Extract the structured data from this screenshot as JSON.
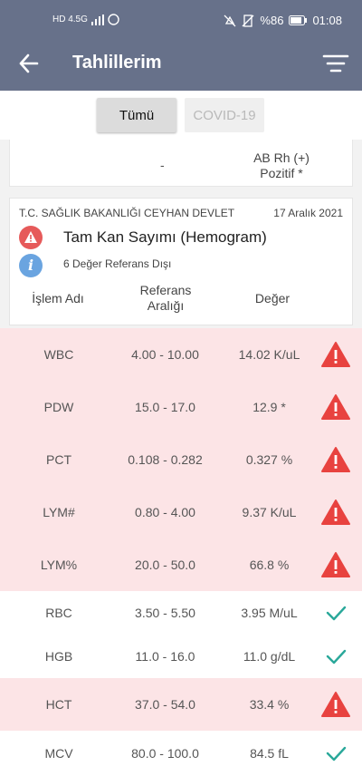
{
  "status_bar": {
    "left_text": "HD 4.5G",
    "battery": "%86",
    "time": "01:08"
  },
  "app_bar": {
    "title": "Tahlillerim",
    "back_icon": "arrow-left-icon",
    "filter_icon": "filter-icon"
  },
  "tabs": [
    {
      "label": "Tümü",
      "active": true
    },
    {
      "label": "COVID-19",
      "active": false
    }
  ],
  "prev_card": {
    "value": "-",
    "blood_group": "AB Rh (+) Pozitif *"
  },
  "test_card": {
    "hospital": "T.C. SAĞLIK BAKANLIĞI CEYHAN DEVLET",
    "date": "17 Aralık 2021",
    "title": "Tam Kan Sayımı (Hemogram)",
    "out_of_range": "6 Değer Referans Dışı",
    "info_glyph": "i",
    "columns": {
      "name": "İşlem Adı",
      "reference": "Referans Aralığı",
      "value": "Değer"
    }
  },
  "results": [
    {
      "name": "WBC",
      "reference": "4.00 - 10.00",
      "value": "14.02 K/uL",
      "status": "abnormal"
    },
    {
      "name": "PDW",
      "reference": "15.0 - 17.0",
      "value": "12.9 *",
      "status": "abnormal"
    },
    {
      "name": "PCT",
      "reference": "0.108 - 0.282",
      "value": "0.327 %",
      "status": "abnormal"
    },
    {
      "name": "LYM#",
      "reference": "0.80 - 4.00",
      "value": "9.37 K/uL",
      "status": "abnormal"
    },
    {
      "name": "LYM%",
      "reference": "20.0 - 50.0",
      "value": "66.8 %",
      "status": "abnormal"
    },
    {
      "name": "RBC",
      "reference": "3.50 - 5.50",
      "value": "3.95 M/uL",
      "status": "normal"
    },
    {
      "name": "HGB",
      "reference": "11.0 - 16.0",
      "value": "11.0 g/dL",
      "status": "normal"
    },
    {
      "name": "HCT",
      "reference": "37.0 - 54.0",
      "value": "33.4 %",
      "status": "abnormal"
    },
    {
      "name": "MCV",
      "reference": "80.0 - 100.0",
      "value": "84.5 fL",
      "status": "normal"
    }
  ],
  "colors": {
    "app_bar": "#67718a",
    "abnormal_row": "#fce4e6",
    "warning": "#e8423f",
    "check": "#2aa89a"
  }
}
